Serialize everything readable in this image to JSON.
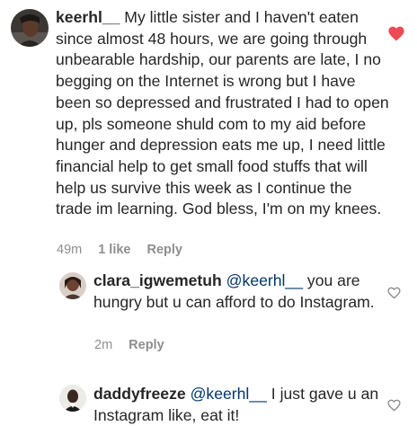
{
  "comments": [
    {
      "username": "keerhl__",
      "text": " My little sister and I haven't eaten since almost 48 hours, we are going through unbearable hardship, our parents are late, I no begging on the Internet is wrong but I have been so depressed and frustrated I had to open up, pls someone shuld com to my aid before hunger and depression eats me up, I need little financial help to get small food stuffs that will help us survive this week as I continue the trade im learning. God bless, I'm on my knees.",
      "time": "49m",
      "likes": "1 like",
      "reply_label": "Reply",
      "liked": true,
      "heart_color": "#ed4956"
    },
    {
      "username": "clara_igwemetuh",
      "mention": "@keerhl__",
      "text": " you are hungry but u can afford to do Instagram.",
      "time": "2m",
      "reply_label": "Reply",
      "liked": false
    },
    {
      "username": "daddyfreeze",
      "mention": "@keerhl__",
      "text": " I just gave u an Instagram like, eat it!",
      "liked": false
    }
  ],
  "icons": {
    "like_filled": "heart-filled-icon",
    "like_outline": "heart-outline-icon"
  }
}
